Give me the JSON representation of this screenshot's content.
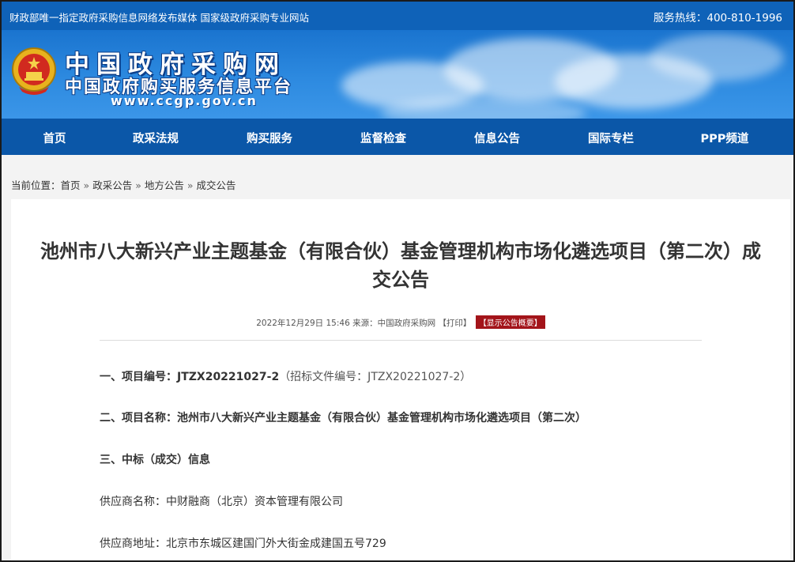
{
  "topbar": {
    "left_text": "财政部唯一指定政府采购信息网络发布媒体 国家级政府采购专业网站",
    "hotline": "服务热线：400-810-1996"
  },
  "banner": {
    "site_title": "中国政府采购网",
    "site_subtitle": "中国政府购买服务信息平台",
    "site_url": "www.ccgp.gov.cn",
    "emblem_icon": "national-emblem-icon"
  },
  "nav": {
    "items": [
      {
        "label": "首页"
      },
      {
        "label": "政采法规"
      },
      {
        "label": "购买服务"
      },
      {
        "label": "监督检查"
      },
      {
        "label": "信息公告"
      },
      {
        "label": "国际专栏"
      },
      {
        "label": "PPP频道"
      }
    ]
  },
  "breadcrumb": {
    "prefix": "当前位置：",
    "items": [
      "首页",
      "政采公告",
      "地方公告",
      "成交公告"
    ],
    "separator": "»"
  },
  "article": {
    "title": "池州市八大新兴产业主题基金（有限合伙）基金管理机构市场化遴选项目（第二次）成交公告",
    "meta_date": "2022年12月29日 15:46",
    "meta_source": "来源：中国政府采购网",
    "meta_print": "【打印】",
    "meta_summary": "【显示公告概要】",
    "sections": {
      "project_no_label": "一、项目编号：",
      "project_no_value": "JTZX20221027-2",
      "project_no_extra": "（招标文件编号：JTZX20221027-2）",
      "project_name_label": "二、项目名称：",
      "project_name_value": "池州市八大新兴产业主题基金（有限合伙）基金管理机构市场化遴选项目（第二次）",
      "winner_heading": "三、中标（成交）信息",
      "supplier_name": "供应商名称：中财融商（北京）资本管理有限公司",
      "supplier_address": "供应商地址：北京市东城区建国门外大街金成建国五号729"
    }
  },
  "colors": {
    "topbar": "#0f62b8",
    "nav": "#0b57a8",
    "summary_button": "#a3141a"
  }
}
